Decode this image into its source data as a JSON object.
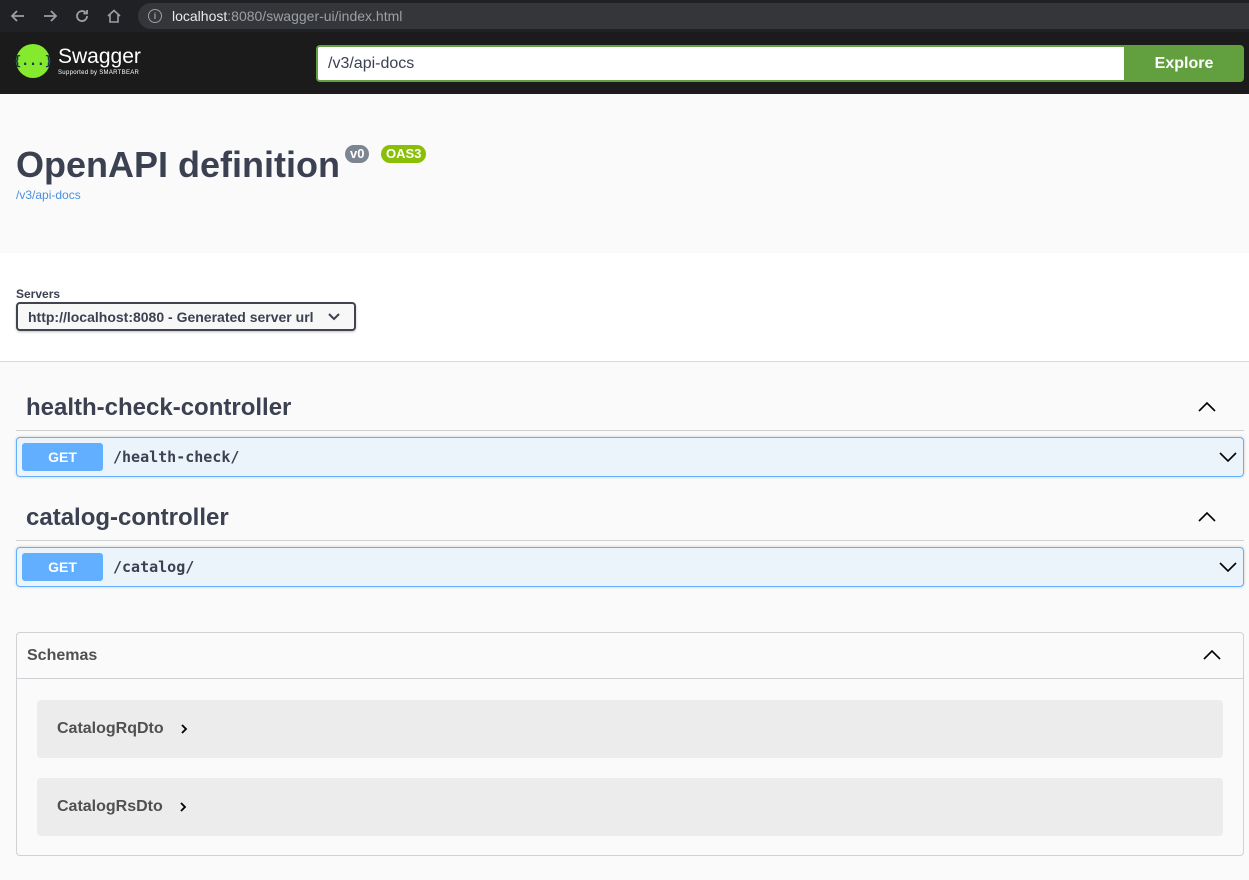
{
  "browser": {
    "url_host": "localhost",
    "url_rest": ":8080/swagger-ui/index.html"
  },
  "topbar": {
    "logo_symbol": "{...}",
    "logo_title": "Swagger",
    "logo_sub": "Supported by SMARTBEAR",
    "url_value": "/v3/api-docs",
    "explore_label": "Explore"
  },
  "info": {
    "title": "OpenAPI definition",
    "version_badge": "v0",
    "oas_badge": "OAS3",
    "link": "/v3/api-docs"
  },
  "servers": {
    "label": "Servers",
    "selected": "http://localhost:8080 - Generated server url"
  },
  "tags": [
    {
      "name": "health-check-controller",
      "operations": [
        {
          "method": "GET",
          "path": "/health-check/"
        }
      ]
    },
    {
      "name": "catalog-controller",
      "operations": [
        {
          "method": "GET",
          "path": "/catalog/"
        }
      ]
    }
  ],
  "schemas": {
    "title": "Schemas",
    "models": [
      "CatalogRqDto",
      "CatalogRsDto"
    ]
  },
  "colors": {
    "get_method": "#61affe",
    "explore_green": "#62a03f",
    "topbar": "#1b1b1b"
  }
}
